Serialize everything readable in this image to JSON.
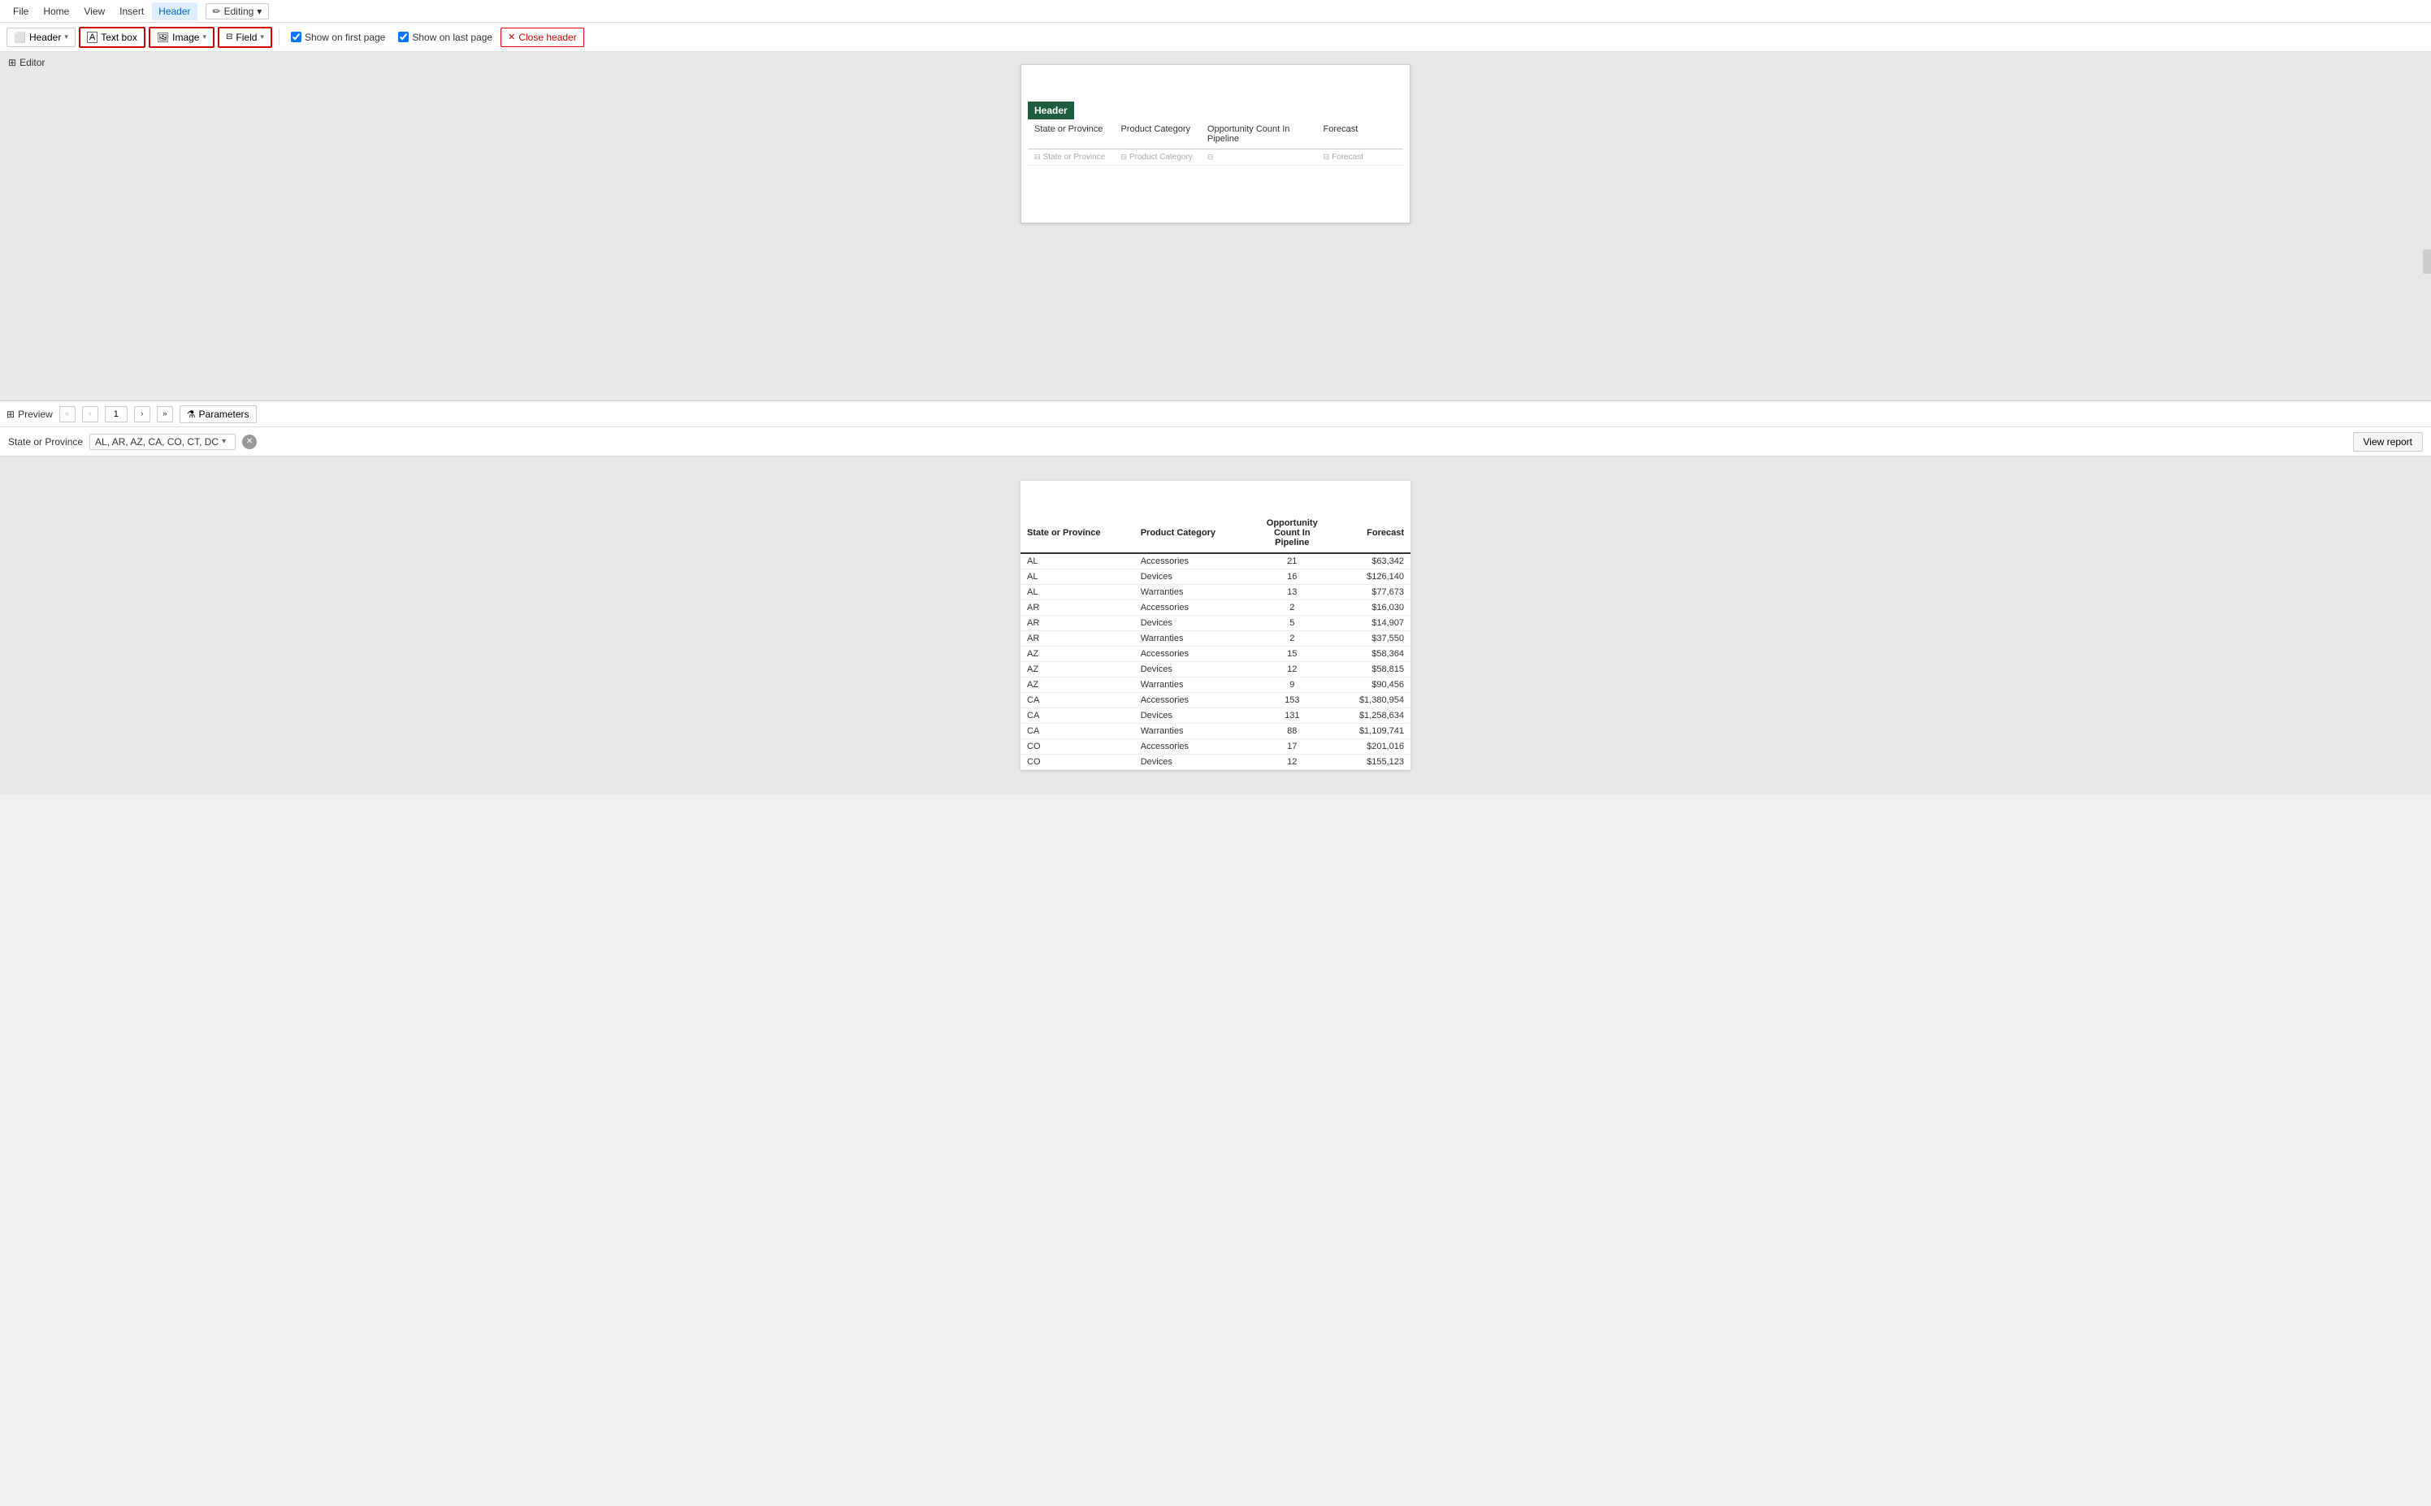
{
  "menu": {
    "items": [
      "File",
      "Home",
      "View",
      "Insert",
      "Header"
    ],
    "active": "Header",
    "editing_badge": "Editing"
  },
  "toolbar": {
    "header_btn": "Header",
    "textbox_btn": "Text box",
    "image_btn": "Image",
    "field_btn": "Field",
    "show_first_label": "Show on first page",
    "show_last_label": "Show on last page",
    "close_header_label": "Close header"
  },
  "editor": {
    "section_label": "Editor",
    "header_band_label": "Header",
    "columns": [
      {
        "label": "State or Province"
      },
      {
        "label": "Product Category"
      },
      {
        "label": "Opportunity Count In Pipeline"
      },
      {
        "label": "Forecast"
      }
    ],
    "data_cells": [
      {
        "icon": "field",
        "label": "State or Province"
      },
      {
        "icon": "field",
        "label": "Product Category"
      },
      {
        "icon": "field",
        "label": ""
      },
      {
        "icon": "field",
        "label": "Forecast"
      }
    ]
  },
  "preview": {
    "section_label": "Preview",
    "page_number": "1",
    "params_btn_label": "Parameters",
    "view_report_btn": "View report"
  },
  "parameters": {
    "label": "State or Province",
    "value": "AL, AR, AZ, CA, CO, CT, DC"
  },
  "table": {
    "columns": [
      {
        "label": "State or Province"
      },
      {
        "label": "Product Category"
      },
      {
        "label": "Opportunity Count In Pipeline",
        "multiline": true
      },
      {
        "label": "Forecast"
      }
    ],
    "rows": [
      {
        "state": "AL",
        "category": "Accessories",
        "count": "21",
        "forecast": "$63,342"
      },
      {
        "state": "AL",
        "category": "Devices",
        "count": "16",
        "forecast": "$126,140"
      },
      {
        "state": "AL",
        "category": "Warranties",
        "count": "13",
        "forecast": "$77,673"
      },
      {
        "state": "AR",
        "category": "Accessories",
        "count": "2",
        "forecast": "$16,030"
      },
      {
        "state": "AR",
        "category": "Devices",
        "count": "5",
        "forecast": "$14,907"
      },
      {
        "state": "AR",
        "category": "Warranties",
        "count": "2",
        "forecast": "$37,550"
      },
      {
        "state": "AZ",
        "category": "Accessories",
        "count": "15",
        "forecast": "$58,364"
      },
      {
        "state": "AZ",
        "category": "Devices",
        "count": "12",
        "forecast": "$58,815"
      },
      {
        "state": "AZ",
        "category": "Warranties",
        "count": "9",
        "forecast": "$90,456"
      },
      {
        "state": "CA",
        "category": "Accessories",
        "count": "153",
        "forecast": "$1,380,954"
      },
      {
        "state": "CA",
        "category": "Devices",
        "count": "131",
        "forecast": "$1,258,634"
      },
      {
        "state": "CA",
        "category": "Warranties",
        "count": "88",
        "forecast": "$1,109,741"
      },
      {
        "state": "CO",
        "category": "Accessories",
        "count": "17",
        "forecast": "$201,016"
      },
      {
        "state": "CO",
        "category": "Devices",
        "count": "12",
        "forecast": "$155,123"
      }
    ]
  },
  "icons": {
    "editor_grid": "⊞",
    "preview_grid": "⊞",
    "pencil": "✏",
    "checkbox_checked": "✓",
    "close_x": "✕",
    "filter": "⚗",
    "nav_first": "«",
    "nav_prev": "‹",
    "nav_next": "›",
    "nav_last": "»",
    "field_icon": "⊟",
    "image_icon": "🖼",
    "header_icon": "⬜"
  }
}
